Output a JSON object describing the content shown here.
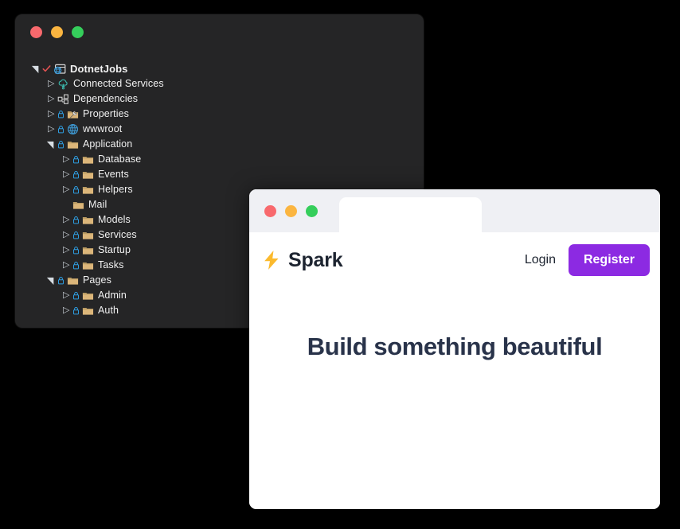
{
  "ide_window": {
    "traffic_lights": [
      {
        "name": "close",
        "color": "#f8696d"
      },
      {
        "name": "minimize",
        "color": "#fbb540"
      },
      {
        "name": "maximize",
        "color": "#35ce5b"
      }
    ],
    "tree": [
      {
        "label": "DotnetJobs",
        "depth": 0,
        "expander": "expanded",
        "icon": "web-project-icon",
        "lock": false,
        "check": true,
        "root": true
      },
      {
        "label": "Connected Services",
        "depth": 1,
        "expander": "collapsed",
        "icon": "connected-services-icon",
        "lock": false,
        "check": false,
        "root": false
      },
      {
        "label": "Dependencies",
        "depth": 1,
        "expander": "collapsed",
        "icon": "dependencies-icon",
        "lock": false,
        "check": false,
        "root": false
      },
      {
        "label": "Properties",
        "depth": 1,
        "expander": "collapsed",
        "icon": "properties-folder-icon",
        "lock": true,
        "check": false,
        "root": false
      },
      {
        "label": "wwwroot",
        "depth": 1,
        "expander": "collapsed",
        "icon": "globe-icon",
        "lock": true,
        "check": false,
        "root": false
      },
      {
        "label": "Application",
        "depth": 1,
        "expander": "expanded",
        "icon": "folder-icon",
        "lock": true,
        "check": false,
        "root": false
      },
      {
        "label": "Database",
        "depth": 2,
        "expander": "collapsed",
        "icon": "folder-icon",
        "lock": true,
        "check": false,
        "root": false
      },
      {
        "label": "Events",
        "depth": 2,
        "expander": "collapsed",
        "icon": "folder-icon",
        "lock": true,
        "check": false,
        "root": false
      },
      {
        "label": "Helpers",
        "depth": 2,
        "expander": "collapsed",
        "icon": "folder-icon",
        "lock": true,
        "check": false,
        "root": false
      },
      {
        "label": "Mail",
        "depth": 2,
        "expander": "blank",
        "icon": "folder-icon",
        "lock": false,
        "check": false,
        "root": false
      },
      {
        "label": "Models",
        "depth": 2,
        "expander": "collapsed",
        "icon": "folder-icon",
        "lock": true,
        "check": false,
        "root": false
      },
      {
        "label": "Services",
        "depth": 2,
        "expander": "collapsed",
        "icon": "folder-icon",
        "lock": true,
        "check": false,
        "root": false
      },
      {
        "label": "Startup",
        "depth": 2,
        "expander": "collapsed",
        "icon": "folder-icon",
        "lock": true,
        "check": false,
        "root": false
      },
      {
        "label": "Tasks",
        "depth": 2,
        "expander": "collapsed",
        "icon": "folder-icon",
        "lock": true,
        "check": false,
        "root": false
      },
      {
        "label": "Pages",
        "depth": 1,
        "expander": "expanded",
        "icon": "folder-icon",
        "lock": true,
        "check": false,
        "root": false
      },
      {
        "label": "Admin",
        "depth": 2,
        "expander": "collapsed",
        "icon": "folder-icon",
        "lock": true,
        "check": false,
        "root": false
      },
      {
        "label": "Auth",
        "depth": 2,
        "expander": "collapsed",
        "icon": "folder-icon",
        "lock": true,
        "check": false,
        "root": false
      }
    ],
    "colors": {
      "background": "#252526",
      "text": "#f1f1f1",
      "folder": "#dcb67a",
      "lock": "#2f9fe3",
      "accent_blue": "#3e9bd6"
    }
  },
  "browser_window": {
    "traffic_lights": [
      {
        "name": "close",
        "color": "#f8696d"
      },
      {
        "name": "minimize",
        "color": "#fbb540"
      },
      {
        "name": "maximize",
        "color": "#35ce5b"
      }
    ],
    "tab": {
      "title": ""
    },
    "site": {
      "brand_name": "Spark",
      "brand_icon": "lightning-bolt-icon",
      "login_label": "Login",
      "register_label": "Register",
      "hero_title": "Build something beautiful",
      "colors": {
        "register_button": "#8c2ae2",
        "bolt": "#fbba2e",
        "hero_text": "#29334a",
        "titlebar": "#eff0f4"
      }
    }
  }
}
